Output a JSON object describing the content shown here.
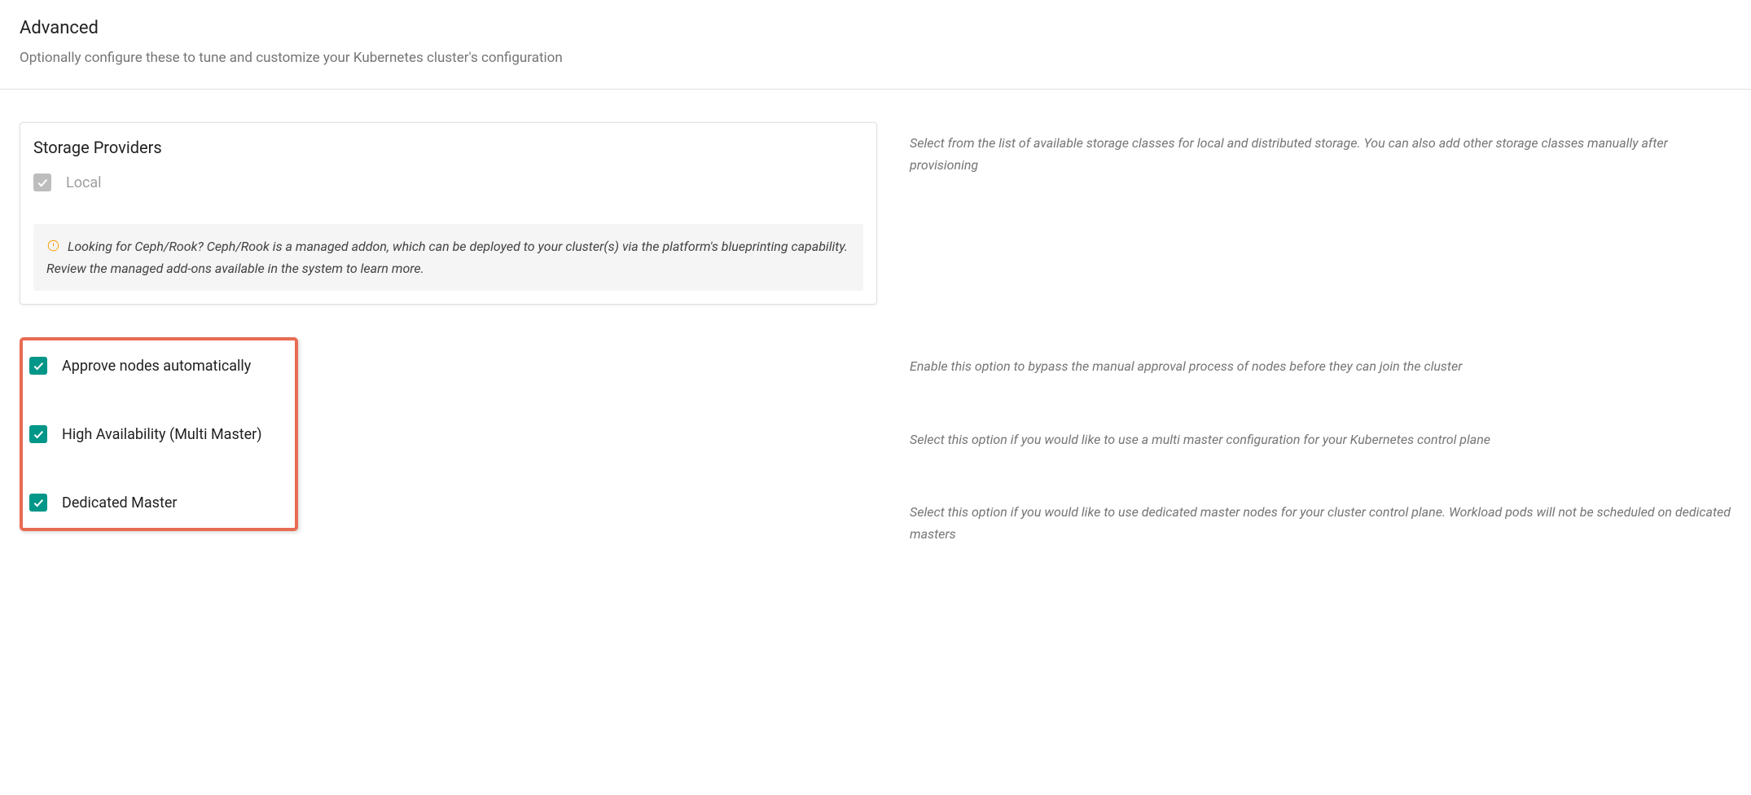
{
  "header": {
    "title": "Advanced",
    "subtitle": "Optionally configure these to tune and customize your Kubernetes cluster's configuration"
  },
  "storage": {
    "card_title": "Storage Providers",
    "local_label": "Local",
    "info_text": "Looking for Ceph/Rook? Ceph/Rook is a managed addon, which can be deployed to your cluster(s) via the platform's blueprinting capability. Review the managed add-ons available in the system to learn more.",
    "help_text": "Select from the list of available storage classes for local and distributed storage. You can also add other storage classes manually after provisioning"
  },
  "options": {
    "approve_nodes": {
      "label": "Approve nodes automatically",
      "help": "Enable this option to bypass the manual approval process of nodes before they can join the cluster"
    },
    "high_availability": {
      "label": "High Availability (Multi Master)",
      "help": "Select this option if you would like to use a multi master configuration for your Kubernetes control plane"
    },
    "dedicated_master": {
      "label": "Dedicated Master",
      "help": "Select this option if you would like to use dedicated master nodes for your cluster control plane. Workload pods will not be scheduled on dedicated masters"
    }
  }
}
